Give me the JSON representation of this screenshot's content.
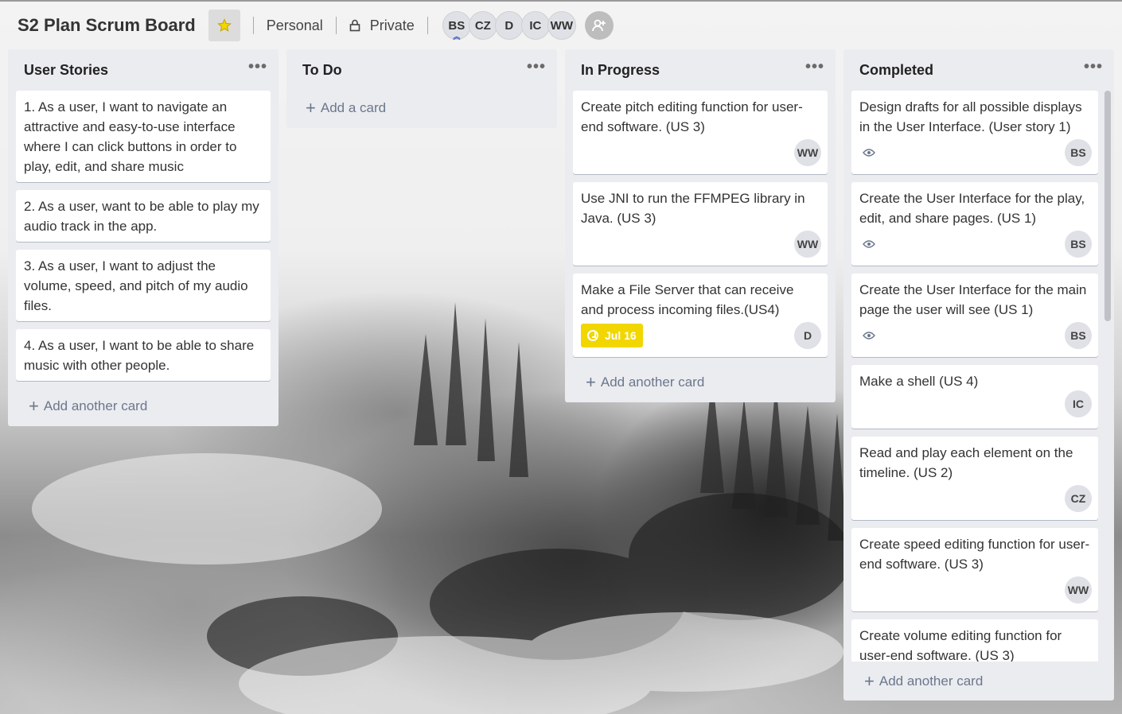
{
  "board": {
    "title": "S2 Plan Scrum Board",
    "workspace": "Personal",
    "visibility": "Private",
    "star_icon": "star-icon",
    "accent_star": "#f2d600"
  },
  "members": [
    "BS",
    "CZ",
    "D",
    "IC",
    "WW"
  ],
  "lists": [
    {
      "title": "User Stories",
      "cards": [
        {
          "text": "1. As a user, I want to navigate an attractive and easy-to-use interface where I can click buttons in order to play, edit, and share music"
        },
        {
          "text": "2. As a user, want to be able to play my audio track in the app."
        },
        {
          "text": "3. As a user, I want to adjust the volume, speed, and pitch of my audio files."
        },
        {
          "text": "4. As a user, I want to be able to share music with other people."
        }
      ],
      "add_label": "Add another card"
    },
    {
      "title": "To Do",
      "cards": [],
      "add_label": "Add a card"
    },
    {
      "title": "In Progress",
      "cards": [
        {
          "text": "Create pitch editing function for user-end software. (US 3)",
          "member": "WW"
        },
        {
          "text": "Use JNI to run the FFMPEG library in Java. (US 3)",
          "member": "WW"
        },
        {
          "text": "Make a File Server that can receive and process incoming files.(US4)",
          "member": "D",
          "due": "Jul 16"
        }
      ],
      "add_label": "Add another card"
    },
    {
      "title": "Completed",
      "cards": [
        {
          "text": "Design drafts for all possible displays in the User Interface. (User story 1)",
          "member": "BS",
          "watch": true
        },
        {
          "text": "Create the User Interface for the play, edit, and share pages. (US 1)",
          "member": "BS",
          "watch": true
        },
        {
          "text": "Create the User Interface for the main page the user will see (US 1)",
          "member": "BS",
          "watch": true
        },
        {
          "text": "Make a shell (US 4)",
          "member": "IC"
        },
        {
          "text": "Read and play each element on the timeline. (US 2)",
          "member": "CZ"
        },
        {
          "text": "Create speed editing function for user-end software. (US 3)",
          "member": "WW"
        },
        {
          "text": "Create volume editing function for user-end software. (US 3)"
        }
      ],
      "add_label": "Add another card"
    }
  ],
  "colors": {
    "list_bg": "#ebecf0",
    "due_badge": "#f2d600"
  }
}
